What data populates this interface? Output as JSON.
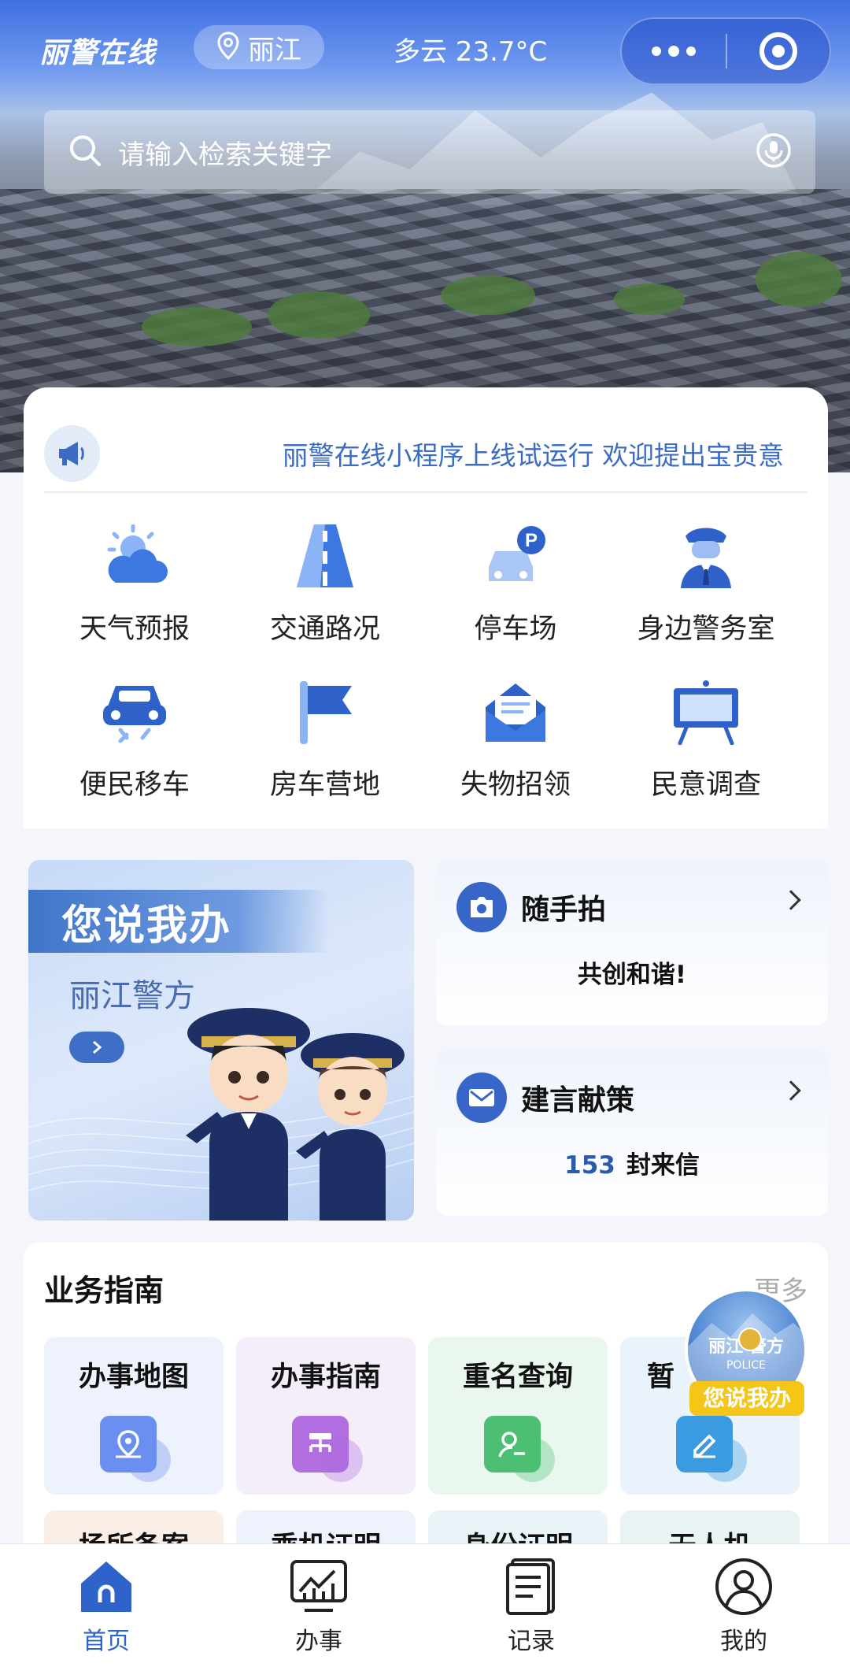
{
  "app": {
    "brand": "丽警在线",
    "location": "丽江",
    "weather": "多云 23.7°C"
  },
  "search": {
    "placeholder": "请输入检索关键字"
  },
  "notice": {
    "text": "丽警在线小程序上线试运行 欢迎提出宝贵意"
  },
  "services": [
    {
      "label": "天气预报",
      "icon": "weather-icon"
    },
    {
      "label": "交通路况",
      "icon": "road-icon"
    },
    {
      "label": "停车场",
      "icon": "parking-icon"
    },
    {
      "label": "身边警务室",
      "icon": "police-officer-icon"
    },
    {
      "label": "便民移车",
      "icon": "car-icon"
    },
    {
      "label": "房车营地",
      "icon": "flag-icon"
    },
    {
      "label": "失物招领",
      "icon": "mail-icon"
    },
    {
      "label": "民意调查",
      "icon": "board-icon"
    }
  ],
  "promo": {
    "banner_title": "您说我办",
    "banner_sub": "丽江警方",
    "snapshot": {
      "title": "随手拍",
      "desc": "共创和谐!"
    },
    "suggest": {
      "title": "建言献策",
      "count": "153",
      "unit": "封来信"
    }
  },
  "guide": {
    "heading": "业务指南",
    "more": "更多",
    "cards": [
      {
        "label": "办事地图",
        "color": "#6a8ff0",
        "bg": "#eef2fc"
      },
      {
        "label": "办事指南",
        "color": "#b06ee0",
        "bg": "#f4eefb"
      },
      {
        "label": "重名查询",
        "color": "#4cbf72",
        "bg": "#eaf7ee"
      },
      {
        "label": "暂",
        "color": "#3a9be0",
        "bg": "#eaf3fb"
      }
    ],
    "cards_row2": [
      {
        "label": "场所备案",
        "bg": "#fbeee6"
      },
      {
        "label": "乘机证明",
        "bg": "#eef2fc"
      },
      {
        "label": "身份证明",
        "bg": "#eaf4f8"
      },
      {
        "label": "无人机",
        "bg": "#eaf3f3"
      }
    ]
  },
  "float_badge": {
    "line1": "丽江  警方",
    "line2": "POLICE",
    "tag": "您说我办"
  },
  "tabbar": [
    {
      "label": "首页",
      "icon": "home-icon",
      "active": true
    },
    {
      "label": "办事",
      "icon": "chart-board-icon",
      "active": false
    },
    {
      "label": "记录",
      "icon": "document-icon",
      "active": false
    },
    {
      "label": "我的",
      "icon": "user-icon",
      "active": false
    }
  ],
  "colors": {
    "accent": "#2e63c9",
    "notice": "#3b6cc5",
    "badge_tag": "#f5c518"
  }
}
